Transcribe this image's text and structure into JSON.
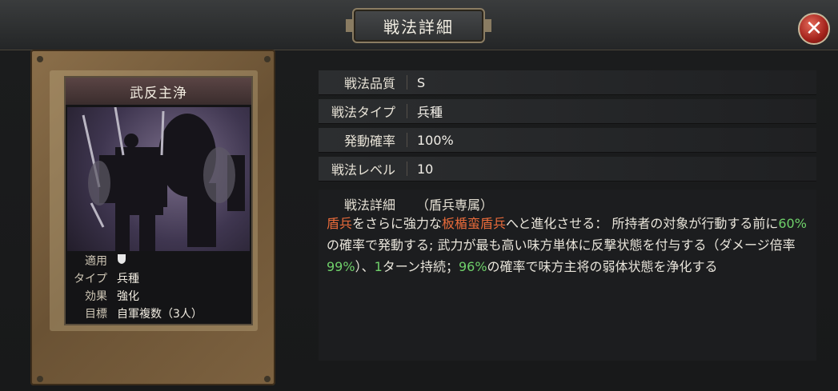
{
  "header": {
    "title": "戦法詳細",
    "close_label": "✕"
  },
  "card": {
    "name": "武反主浄",
    "info": [
      {
        "label": "適用",
        "value": ""
      },
      {
        "label": "タイプ",
        "value": "兵種"
      },
      {
        "label": "効果",
        "value": "強化"
      },
      {
        "label": "目標",
        "value": "自軍複数（3人）"
      }
    ]
  },
  "details": {
    "rows": [
      {
        "label": "戦法品質",
        "value": "S"
      },
      {
        "label": "戦法タイプ",
        "value": "兵種"
      },
      {
        "label": "発動確率",
        "value": "100%"
      },
      {
        "label": "戦法レベル",
        "value": "10"
      }
    ],
    "description": {
      "label": "戦法詳細",
      "subtitle": "（盾兵専属）",
      "segments": [
        {
          "text": "盾兵",
          "style": "red"
        },
        {
          "text": "をさらに強力な",
          "style": "plain"
        },
        {
          "text": "板楯蛮盾兵",
          "style": "red"
        },
        {
          "text": "へと進化させる： 所持者の対象が行動する前に",
          "style": "plain"
        },
        {
          "text": "60%",
          "style": "green"
        },
        {
          "text": "の確率で発動する; 武力が最も高い味方単体に反撃状態を付与する（ダメージ倍率",
          "style": "plain"
        },
        {
          "text": "99%",
          "style": "green"
        },
        {
          "text": "）、",
          "style": "plain"
        },
        {
          "text": "1",
          "style": "green"
        },
        {
          "text": "ターン持続；",
          "style": "plain"
        },
        {
          "text": "96%",
          "style": "green"
        },
        {
          "text": "の確率で味方主将の弱体状態を浄化する",
          "style": "plain"
        }
      ]
    }
  },
  "colors": {
    "accent_red": "#e86a3a",
    "accent_green": "#6fd06a"
  }
}
